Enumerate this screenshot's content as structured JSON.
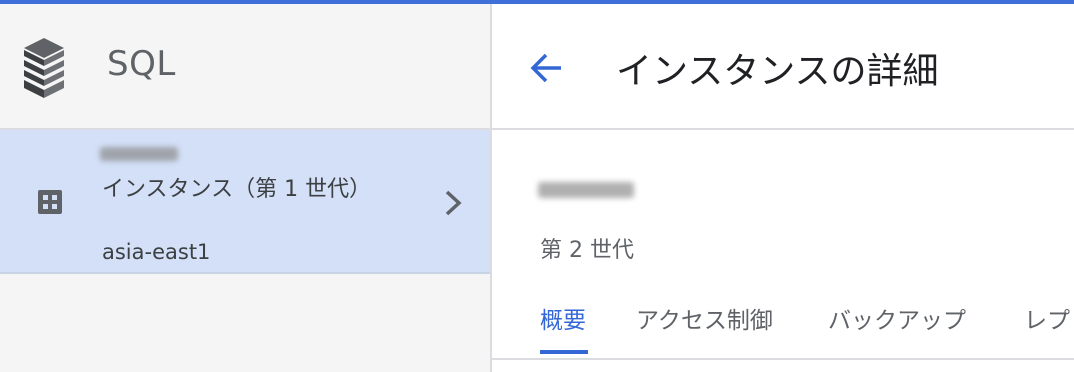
{
  "colors": {
    "accent": "#3367d6",
    "selected_bg": "#d3e0f7",
    "sidebar_bg": "#f5f5f5"
  },
  "sidebar": {
    "product_name": "SQL",
    "product_icon": "sql-stack-icon",
    "instances": [
      {
        "type": "インスタンス（第 1 世代）",
        "region": "asia-east1",
        "icon": "grid-icon",
        "chevron": "chevron-right-icon"
      }
    ]
  },
  "main": {
    "back_icon": "arrow-back-icon",
    "title": "インスタンスの詳細",
    "generation": "第 2 世代",
    "tabs": [
      {
        "label": "概要",
        "active": true
      },
      {
        "label": "アクセス制御"
      },
      {
        "label": "バックアップ"
      },
      {
        "label": "レプ"
      }
    ]
  }
}
